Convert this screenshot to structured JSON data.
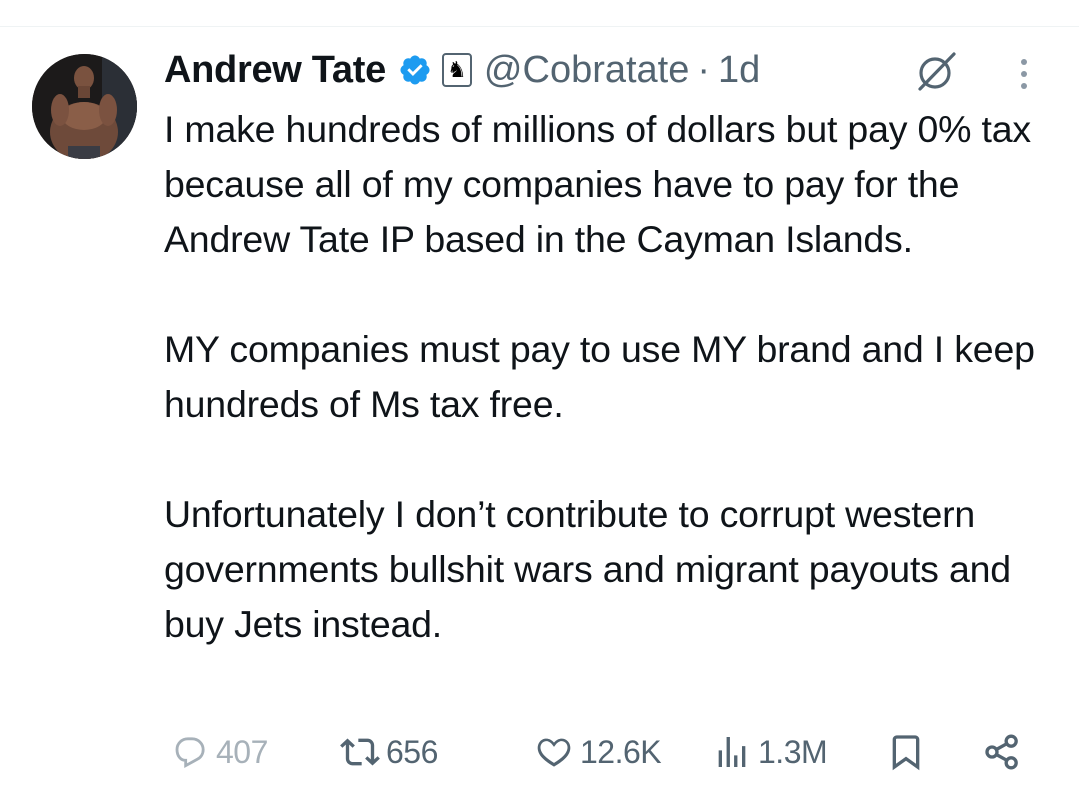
{
  "tweet": {
    "author": {
      "display_name": "Andrew Tate",
      "handle": "@Cobratate",
      "verified": true,
      "affiliate_badge": "♞"
    },
    "separator": "·",
    "time": "1d",
    "paragraphs": [
      "I make hundreds of millions of dollars but pay 0% tax because all of my companies have to pay for the Andrew Tate IP based in the Cayman Islands.",
      "MY companies must pay to use MY brand and I keep hundreds of Ms tax free.",
      "Unfortunately I don’t contribute to corrupt western governments bullshit wars and migrant payouts and buy Jets instead."
    ],
    "actions": {
      "replies": "407",
      "retweets": "656",
      "likes": "12.6K",
      "views": "1.3M"
    }
  },
  "icons": {
    "verified": "verified-badge-icon",
    "grok": "grok-icon",
    "more": "more-icon",
    "reply": "reply-icon",
    "retweet": "retweet-icon",
    "like": "heart-icon",
    "views": "views-icon",
    "bookmark": "bookmark-icon",
    "share": "share-icon"
  },
  "colors": {
    "text": "#0f1419",
    "secondary": "#536471",
    "verified_blue": "#1d9bf0",
    "reply_faded": "#a7b1b9"
  }
}
